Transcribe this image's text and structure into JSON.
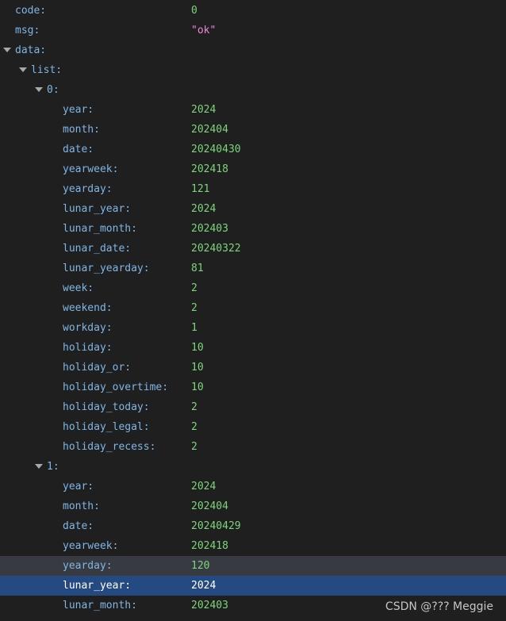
{
  "root": {
    "code_key": "code:",
    "code_value": "0",
    "msg_key": "msg:",
    "msg_value": "\"ok\"",
    "data_key": "data:",
    "list_key": "list:"
  },
  "items": [
    {
      "index_label": "0:",
      "fields": [
        {
          "key": "year:",
          "value": "2024"
        },
        {
          "key": "month:",
          "value": "202404"
        },
        {
          "key": "date:",
          "value": "20240430"
        },
        {
          "key": "yearweek:",
          "value": "202418"
        },
        {
          "key": "yearday:",
          "value": "121"
        },
        {
          "key": "lunar_year:",
          "value": "2024"
        },
        {
          "key": "lunar_month:",
          "value": "202403"
        },
        {
          "key": "lunar_date:",
          "value": "20240322"
        },
        {
          "key": "lunar_yearday:",
          "value": "81"
        },
        {
          "key": "week:",
          "value": "2"
        },
        {
          "key": "weekend:",
          "value": "2"
        },
        {
          "key": "workday:",
          "value": "1"
        },
        {
          "key": "holiday:",
          "value": "10"
        },
        {
          "key": "holiday_or:",
          "value": "10"
        },
        {
          "key": "holiday_overtime:",
          "value": "10"
        },
        {
          "key": "holiday_today:",
          "value": "2"
        },
        {
          "key": "holiday_legal:",
          "value": "2"
        },
        {
          "key": "holiday_recess:",
          "value": "2"
        }
      ]
    },
    {
      "index_label": "1:",
      "fields": [
        {
          "key": "year:",
          "value": "2024"
        },
        {
          "key": "month:",
          "value": "202404"
        },
        {
          "key": "date:",
          "value": "20240429"
        },
        {
          "key": "yearweek:",
          "value": "202418"
        },
        {
          "key": "yearday:",
          "value": "120"
        },
        {
          "key": "lunar_year:",
          "value": "2024"
        },
        {
          "key": "lunar_month:",
          "value": "202403"
        }
      ]
    }
  ],
  "watermark": "CSDN @??? Meggie",
  "colors": {
    "background": "#1f1f1f",
    "key": "#7fb6e6",
    "number": "#7dd57b",
    "string": "#e88ad6",
    "hover_row": "#373b41",
    "selected_row": "#254a82"
  }
}
